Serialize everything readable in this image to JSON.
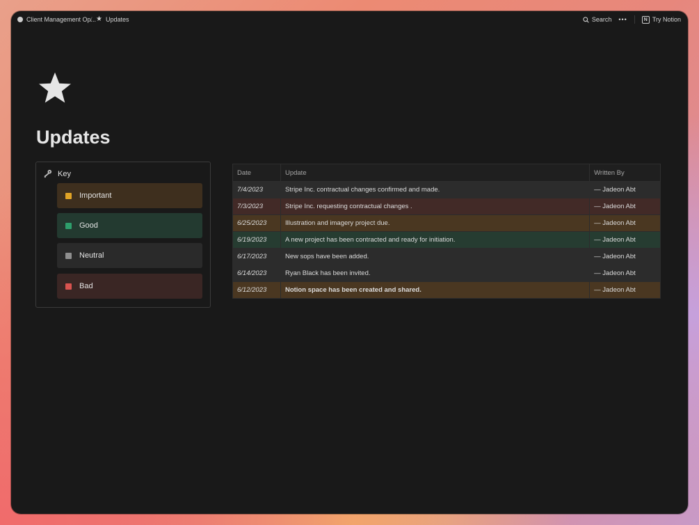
{
  "topbar": {
    "breadcrumb_parent": "Client Management Op...",
    "breadcrumb_separator": "/",
    "breadcrumb_current": "Updates",
    "search_label": "Search",
    "more_label": "•••",
    "try_label": "Try Notion"
  },
  "page": {
    "title": "Updates"
  },
  "key": {
    "heading": "Key",
    "items": [
      {
        "label": "Important",
        "color": "#e0a326",
        "bg": "#3e2f1e"
      },
      {
        "label": "Good",
        "color": "#2e9f6c",
        "bg": "#233a30"
      },
      {
        "label": "Neutral",
        "color": "#8f8f8f",
        "bg": "#2a2a2a"
      },
      {
        "label": "Bad",
        "color": "#d9534f",
        "bg": "#3a2624"
      }
    ]
  },
  "table": {
    "headers": [
      "Date",
      "Update",
      "Written By"
    ],
    "rows": [
      {
        "date": "7/4/2023",
        "update": "Stripe Inc. contractual changes confirmed and made.",
        "author": "— Jadeon Abt",
        "tone": "default"
      },
      {
        "date": "7/3/2023",
        "update": "Stripe Inc. requesting contractual changes .",
        "author": "— Jadeon Abt",
        "tone": "red"
      },
      {
        "date": "6/25/2023",
        "update": "Illustration and imagery project due.",
        "author": "— Jadeon Abt",
        "tone": "orange"
      },
      {
        "date": "6/19/2023",
        "update": "A new project has been contracted and ready for initiation.",
        "author": "— Jadeon Abt",
        "tone": "green"
      },
      {
        "date": "6/17/2023",
        "update": "New sops have been added.",
        "author": "— Jadeon Abt",
        "tone": "default"
      },
      {
        "date": "6/14/2023",
        "update": "Ryan Black has been invited.",
        "author": "— Jadeon Abt",
        "tone": "default"
      },
      {
        "date": "6/12/2023",
        "update": "Notion space has been created and shared.",
        "author": "— Jadeon Abt",
        "tone": "orange",
        "bold": true
      }
    ]
  }
}
